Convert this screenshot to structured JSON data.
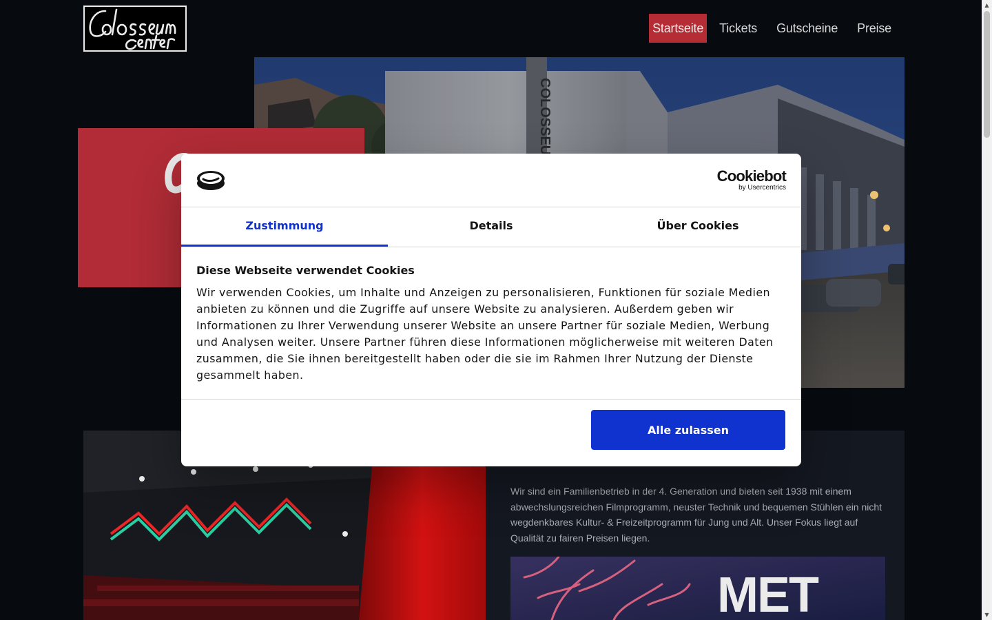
{
  "header": {
    "logo_alt": "Colosseum Center",
    "nav": [
      {
        "label": "Startseite",
        "active": true
      },
      {
        "label": "Tickets",
        "active": false
      },
      {
        "label": "Gutscheine",
        "active": false
      },
      {
        "label": "Preise",
        "active": false
      }
    ]
  },
  "hero": {
    "building_sign": "COLOSSEU"
  },
  "about": {
    "text": "Wir sind ein Familienbetrieb in der 4. Generation und bieten seit 1938 mit einem abwechslungsreichen Filmprogramm, neuster Technik und bequemen Stühlen ein nicht wegdenkbares Kultur- & Freizeitprogramm für Jung und Alt. Unser Fokus liegt auf Qualität zu fairen Preisen liegen.",
    "banner_text": "MET"
  },
  "cookie_dialog": {
    "brand": "Cookiebot",
    "brand_sub": "by Usercentrics",
    "tabs": [
      {
        "label": "Zustimmung",
        "active": true
      },
      {
        "label": "Details",
        "active": false
      },
      {
        "label": "Über Cookies",
        "active": false
      }
    ],
    "title": "Diese Webseite verwendet Cookies",
    "body": "Wir verwenden Cookies, um Inhalte und Anzeigen zu personalisieren, Funktionen für soziale Medien anbieten zu können und die Zugriffe auf unsere Website zu analysieren. Außerdem geben wir Informationen zu Ihrer Verwendung unserer Website an unsere Partner für soziale Medien, Werbung und Analysen weiter. Unsere Partner führen diese Informationen möglicherweise mit weiteren Daten zusammen, die Sie ihnen bereitgestellt haben oder die sie im Rahmen Ihrer Nutzung der Dienste gesammelt haben.",
    "allow_all_label": "Alle zulassen"
  },
  "colors": {
    "background": "#080c12",
    "accent_red": "#c5303a",
    "cookiebot_blue": "#1032cf",
    "card_bg": "#161b24"
  }
}
